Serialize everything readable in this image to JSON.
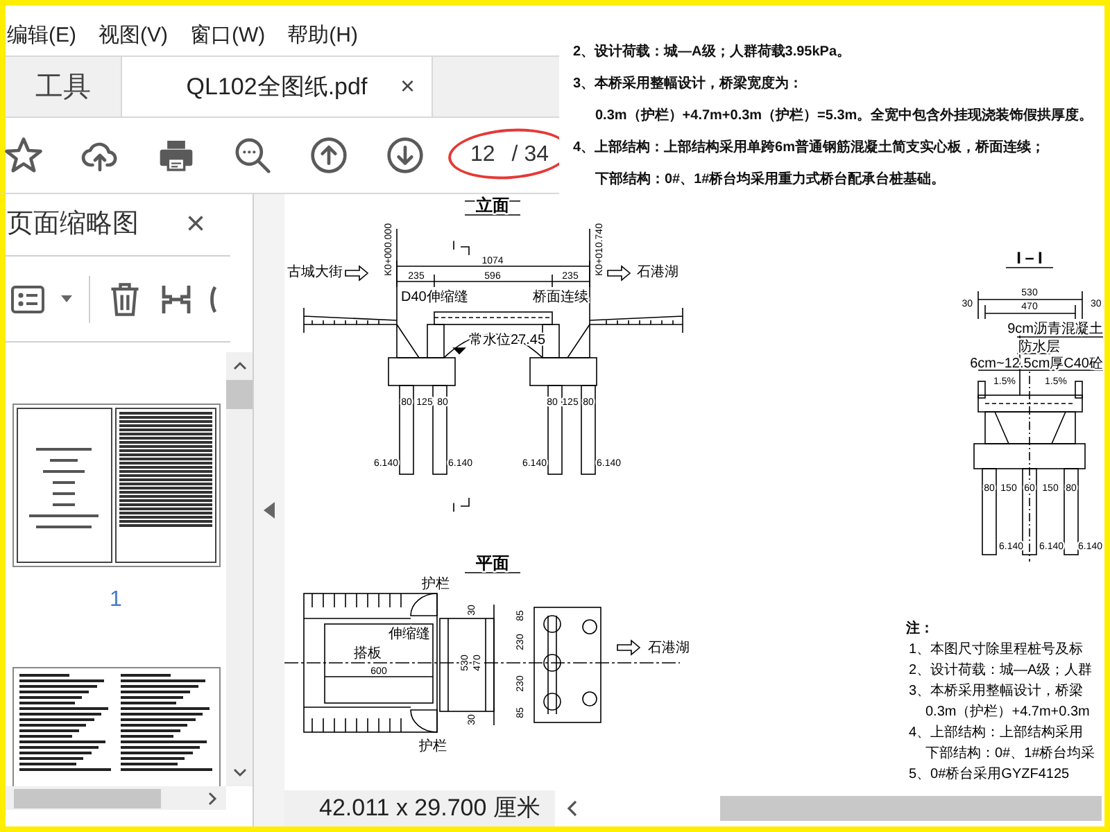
{
  "menu_bar": [
    "编辑(E)",
    "视图(V)",
    "窗口(W)",
    "帮助(H)"
  ],
  "tabs": [
    {
      "label": "工具",
      "selected": false
    },
    {
      "label": "QL102全图纸.pdf",
      "selected": true,
      "close": "×"
    }
  ],
  "toolbar": {
    "page_current": "12",
    "page_total": "/ 34",
    "page_highlighted": true
  },
  "thumbnail_panel": {
    "title": "页面缩略图",
    "close": "×",
    "pages": [
      {
        "kind": "drawing-list",
        "label": "1"
      },
      {
        "kind": "text"
      }
    ]
  },
  "inset_notes": [
    {
      "text": "2、设计荷载：城—A级；人群荷载3.95kPa。",
      "indent": false
    },
    {
      "text": "3、本桥采用整幅设计，桥梁宽度为：",
      "indent": false
    },
    {
      "text": "0.3m（护栏）+4.7m+0.3m（护栏）=5.3m。全宽中包含外挂现浇装饰假拱厚度。",
      "indent": true
    },
    {
      "text": "4、上部结构：上部结构采用单跨6m普通钢筋混凝土简支实心板，桥面连续；",
      "indent": false
    },
    {
      "text": "下部结构：0#、1#桥台均采用重力式桥台配承台桩基础。",
      "indent": true
    }
  ],
  "document": {
    "elevation": {
      "title": "立面",
      "labels": [
        "K0+000.000",
        "I",
        "1074",
        "K0+010.740",
        "古城大街",
        "235",
        "596",
        "235",
        "石港湖",
        "D40伸缩缝",
        "桥面连续",
        "常水位27.45",
        "80",
        "125",
        "80",
        "80",
        "125",
        "80",
        "6.140",
        "6.140",
        "6.140",
        "6.140",
        "I"
      ]
    },
    "cross_section": {
      "title": "I－I",
      "labels": [
        "530",
        "30",
        "470",
        "30",
        "9cm沥青混凝土",
        "防水层",
        "6cm~12.5cm厚C40砼",
        "1.5%",
        "1.5%",
        "80",
        "150",
        "60",
        "150",
        "80",
        "6.140",
        "6.140",
        "6.140"
      ]
    },
    "plan": {
      "title": "平面",
      "labels": [
        "护栏",
        "30",
        "85",
        "伸缩缝",
        "230",
        "搭板",
        "530",
        "470",
        "石港湖",
        "600",
        "230",
        "85",
        "30",
        "护栏"
      ]
    },
    "notes": {
      "heading": "注：",
      "items": [
        {
          "text": "1、本图尺寸除里程桩号及标"
        },
        {
          "text": "2、设计荷载：城—A级；人群"
        },
        {
          "text": "3、本桥采用整幅设计，桥梁",
          "continuation": "0.3m（护栏）+4.7m+0.3m"
        },
        {
          "text": "4、上部结构：上部结构采用",
          "continuation": "下部结构：0#、1#桥台均采"
        },
        {
          "text": "5、0#桥台采用GYZF4125"
        }
      ]
    }
  },
  "status_bar": {
    "page_size": "42.011 x 29.700 厘米"
  }
}
